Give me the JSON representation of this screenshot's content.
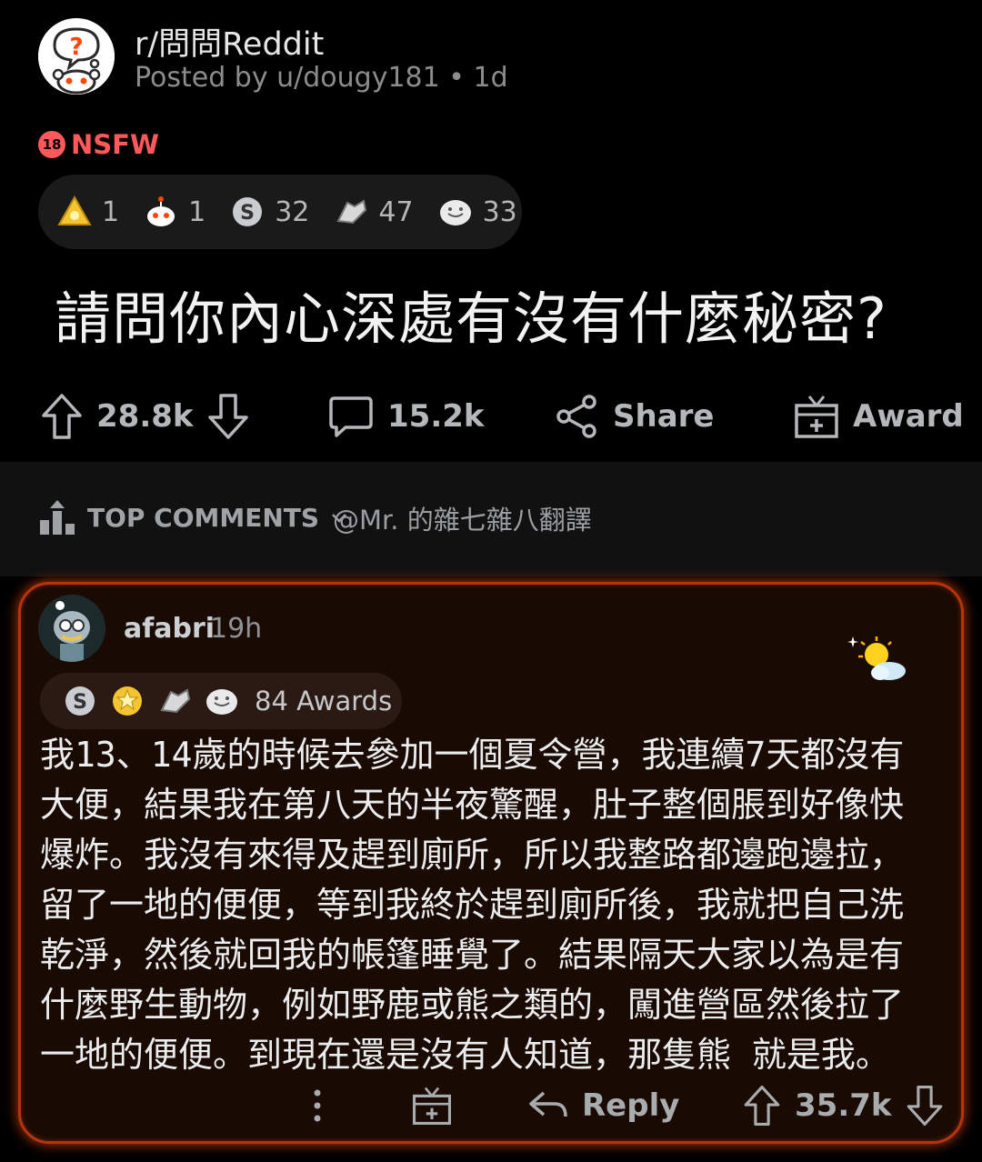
{
  "post": {
    "subreddit": "r/問問Reddit",
    "posted_by": "Posted by u/dougy181 • 1d",
    "nsfw_badge": "18",
    "nsfw_label": "NSFW",
    "awards": [
      {
        "icon": "gold-triangle-award-icon",
        "count": "1"
      },
      {
        "icon": "snoo-award-icon",
        "count": "1"
      },
      {
        "icon": "silver-award-icon",
        "count": "32"
      },
      {
        "icon": "helpful-hand-award-icon",
        "count": "47"
      },
      {
        "icon": "wholesome-award-icon",
        "count": "33"
      }
    ],
    "title": "請問你內心深處有沒有什麼秘密?",
    "upvotes": "28.8k",
    "comments": "15.2k",
    "share_label": "Share",
    "award_label": "Award"
  },
  "sort": {
    "label": "TOP COMMENTS",
    "watermark": "@Mr. 的雜七雜八翻譯"
  },
  "comment": {
    "username": "afabri",
    "time": "19h",
    "awards_label": "84 Awards",
    "award_icons": [
      "silver-award-icon",
      "gold-star-award-icon",
      "helpful-hand-award-icon",
      "wholesome-award-icon"
    ],
    "flair_icon": "sun-cloud-flair-icon",
    "body": "我13、14歲的時候去參加一個夏令營，我連續7天都沒有\n大便，結果我在第八天的半夜驚醒，肚子整個脹到好像快\n爆炸。我沒有來得及趕到廁所，所以我整路都邊跑邊拉，\n留了一地的便便，等到我終於趕到廁所後，我就把自己洗\n乾淨，然後就回我的帳篷睡覺了。結果隔天大家以為是有\n什麼野生動物，例如野鹿或熊之類的，闖進營區然後拉了\n一地的便便。到現在還是沒有人知道，那隻熊 就是我。",
    "reply_label": "Reply",
    "score": "35.7k"
  },
  "colors": {
    "background": "#000000",
    "card_bg": "#1a0a04",
    "card_border": "#b4350d",
    "nsfw": "#ff585b"
  }
}
